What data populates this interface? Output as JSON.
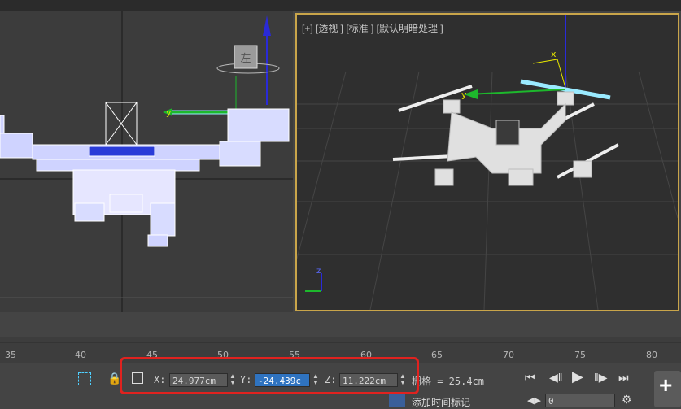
{
  "viewport_right": {
    "label": "[+] [透视 ] [标准 ] [默认明暗处理 ]"
  },
  "viewcube": {
    "face_label": "左"
  },
  "ruler": {
    "ticks": [
      "35",
      "40",
      "45",
      "50",
      "55",
      "60",
      "65",
      "70",
      "75",
      "80"
    ]
  },
  "coords": {
    "x_label": "X:",
    "x_value": "24.977cm",
    "y_label": "Y:",
    "y_value": "-24.439c",
    "z_label": "Z:",
    "z_value": "11.222cm",
    "grid_text": "栅格 = 25.4cm"
  },
  "time_tag": {
    "label": "添加时间标记"
  },
  "frame": {
    "value": "0"
  },
  "axis_labels": {
    "x": "x",
    "y": "y",
    "z": "z"
  },
  "colors": {
    "accent_highlight": "#e0221f",
    "viewport_active_border": "#c9a54a",
    "field_selected": "#2f73c0"
  }
}
